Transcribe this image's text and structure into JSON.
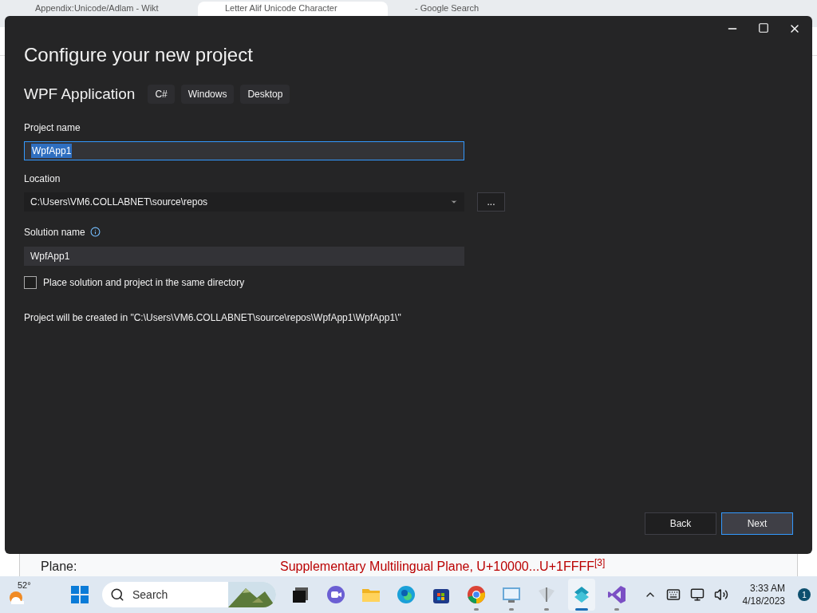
{
  "browser": {
    "tabs": [
      {
        "label": "Appendix:Unicode/Adlam - Wikt",
        "selected": false
      },
      {
        "label": "Letter Alif Unicode Character",
        "selected": true
      },
      {
        "label": "- Google Search",
        "selected": false
      }
    ],
    "page_row": {
      "label": "Plane:",
      "value": "Supplementary Multilingual Plane, U+10000...U+1FFFF",
      "footnote": "[3]"
    }
  },
  "dialog": {
    "title": "Configure your new project",
    "template": {
      "name": "WPF Application",
      "tags": [
        "C#",
        "Windows",
        "Desktop"
      ]
    },
    "project_name": {
      "label": "Project name",
      "value": "WpfApp1",
      "text_selected": true
    },
    "location": {
      "label": "Location",
      "value": "C:\\Users\\VM6.COLLABNET\\source\\repos",
      "browse": "..."
    },
    "solution_name": {
      "label": "Solution name",
      "value": "WpfApp1"
    },
    "same_directory": {
      "label": "Place solution and project in the same directory",
      "checked": false
    },
    "summary": "Project will be created in \"C:\\Users\\VM6.COLLABNET\\source\\repos\\WpfApp1\\WpfApp1\\\"",
    "buttons": [
      {
        "label": "Back",
        "primary": false
      },
      {
        "label": "Next",
        "primary": true
      }
    ]
  },
  "taskbar": {
    "weather": "52°",
    "search_placeholder": "Search",
    "apps": [
      {
        "kind": "taskview",
        "running": false,
        "selected": false
      },
      {
        "kind": "meet",
        "running": false,
        "selected": false
      },
      {
        "kind": "folder",
        "running": false,
        "selected": false
      },
      {
        "kind": "edge",
        "running": false,
        "selected": false
      },
      {
        "kind": "store",
        "running": false,
        "selected": false
      },
      {
        "kind": "chrome",
        "running": true,
        "selected": false
      },
      {
        "kind": "monitor",
        "running": true,
        "selected": false
      },
      {
        "kind": "xps",
        "running": true,
        "selected": false
      },
      {
        "kind": "installer",
        "running": true,
        "selected": true
      },
      {
        "kind": "vs",
        "running": true,
        "selected": false
      }
    ],
    "time": "3:33 AM",
    "date": "4/18/2023",
    "notifications": "1"
  }
}
